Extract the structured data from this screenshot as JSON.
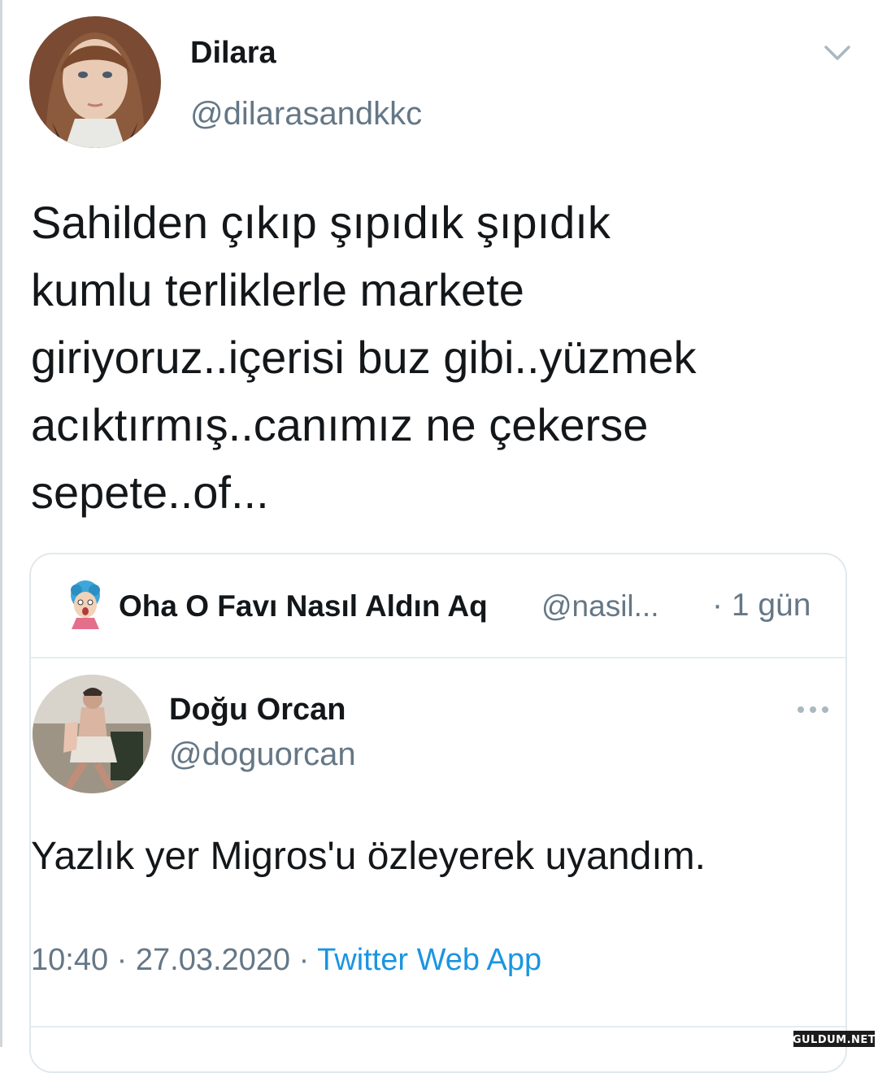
{
  "tweet": {
    "author": {
      "name": "Dilara",
      "handle": "@dilarasandkkc"
    },
    "text_lines": [
      "Sahilden çıkıp şıpıdık şıpıdık",
      "kumlu terliklerle markete",
      "giriyoruz..içerisi buz gibi..yüzmek",
      "acıktırmış..canımız ne çekerse",
      "sepete..of..."
    ],
    "menu_icon": "chevron-down-icon"
  },
  "quote": {
    "account_name": "Oha O Favı Nasıl Aldın Aq",
    "account_handle": "@nasil...",
    "time": "· 1 gün",
    "inner": {
      "author": {
        "name": "Doğu Orcan",
        "handle": "@doguorcan"
      },
      "text": "Yazlık yer Migros'u özleyerek uyandım.",
      "time": "10:40 · 27.03.2020 · ",
      "source": "Twitter Web App",
      "menu_icon": "more-dots-icon"
    }
  },
  "watermark": {
    "logo_text": "GULDUM.NET"
  },
  "colors": {
    "text": "#14171a",
    "secondary": "#657786",
    "link": "#1b95e0",
    "border": "#e1e8ed"
  }
}
